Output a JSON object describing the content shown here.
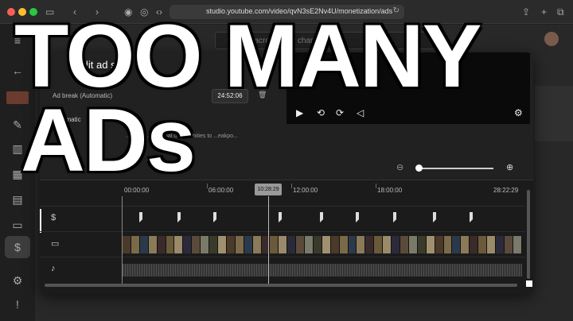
{
  "browser": {
    "url": "studio.youtube.com/video/qvN3sE2Nv4U/monetization/ads",
    "icons": [
      "sidebar-icon",
      "back-icon",
      "forward-icon",
      "rss-icon",
      "extension-icon",
      "code-icon",
      "reader-icon",
      "reload-icon",
      "share-icon",
      "new-tab-icon",
      "tabs-icon"
    ]
  },
  "studio": {
    "search_placeholder": "Search across your channel",
    "rail_icons": [
      "menu-icon",
      "back-arrow-icon",
      "edit-icon",
      "analytics-icon",
      "editor-icon",
      "comments-icon",
      "subtitles-icon",
      "monetization-icon",
      "settings-icon",
      "feedback-icon"
    ]
  },
  "modal": {
    "title": "Edit ad slots",
    "slot": {
      "label": "Ad break (Automatic)",
      "time": "24:52:06",
      "sub": "Automatic",
      "desc": "...side m... ...sional opportunities to ...eakpo..."
    }
  },
  "timeline": {
    "ruler_labels": [
      "00:00:00",
      "06:00:00",
      "12:00:00",
      "18:00:00",
      "28:22:29"
    ],
    "playhead_time": "10:28:29",
    "track_icons": [
      "dollar-icon",
      "video-icon",
      "music-note-icon"
    ],
    "ad_markers_count": 12
  },
  "overlay": {
    "line1": "TOO MANY",
    "line2": "ADs"
  },
  "colors": {
    "accent": "#ffffff",
    "background": "#1f1f1f",
    "traffic_red": "#ff5f57",
    "traffic_yellow": "#febc2e",
    "traffic_green": "#28c840"
  }
}
